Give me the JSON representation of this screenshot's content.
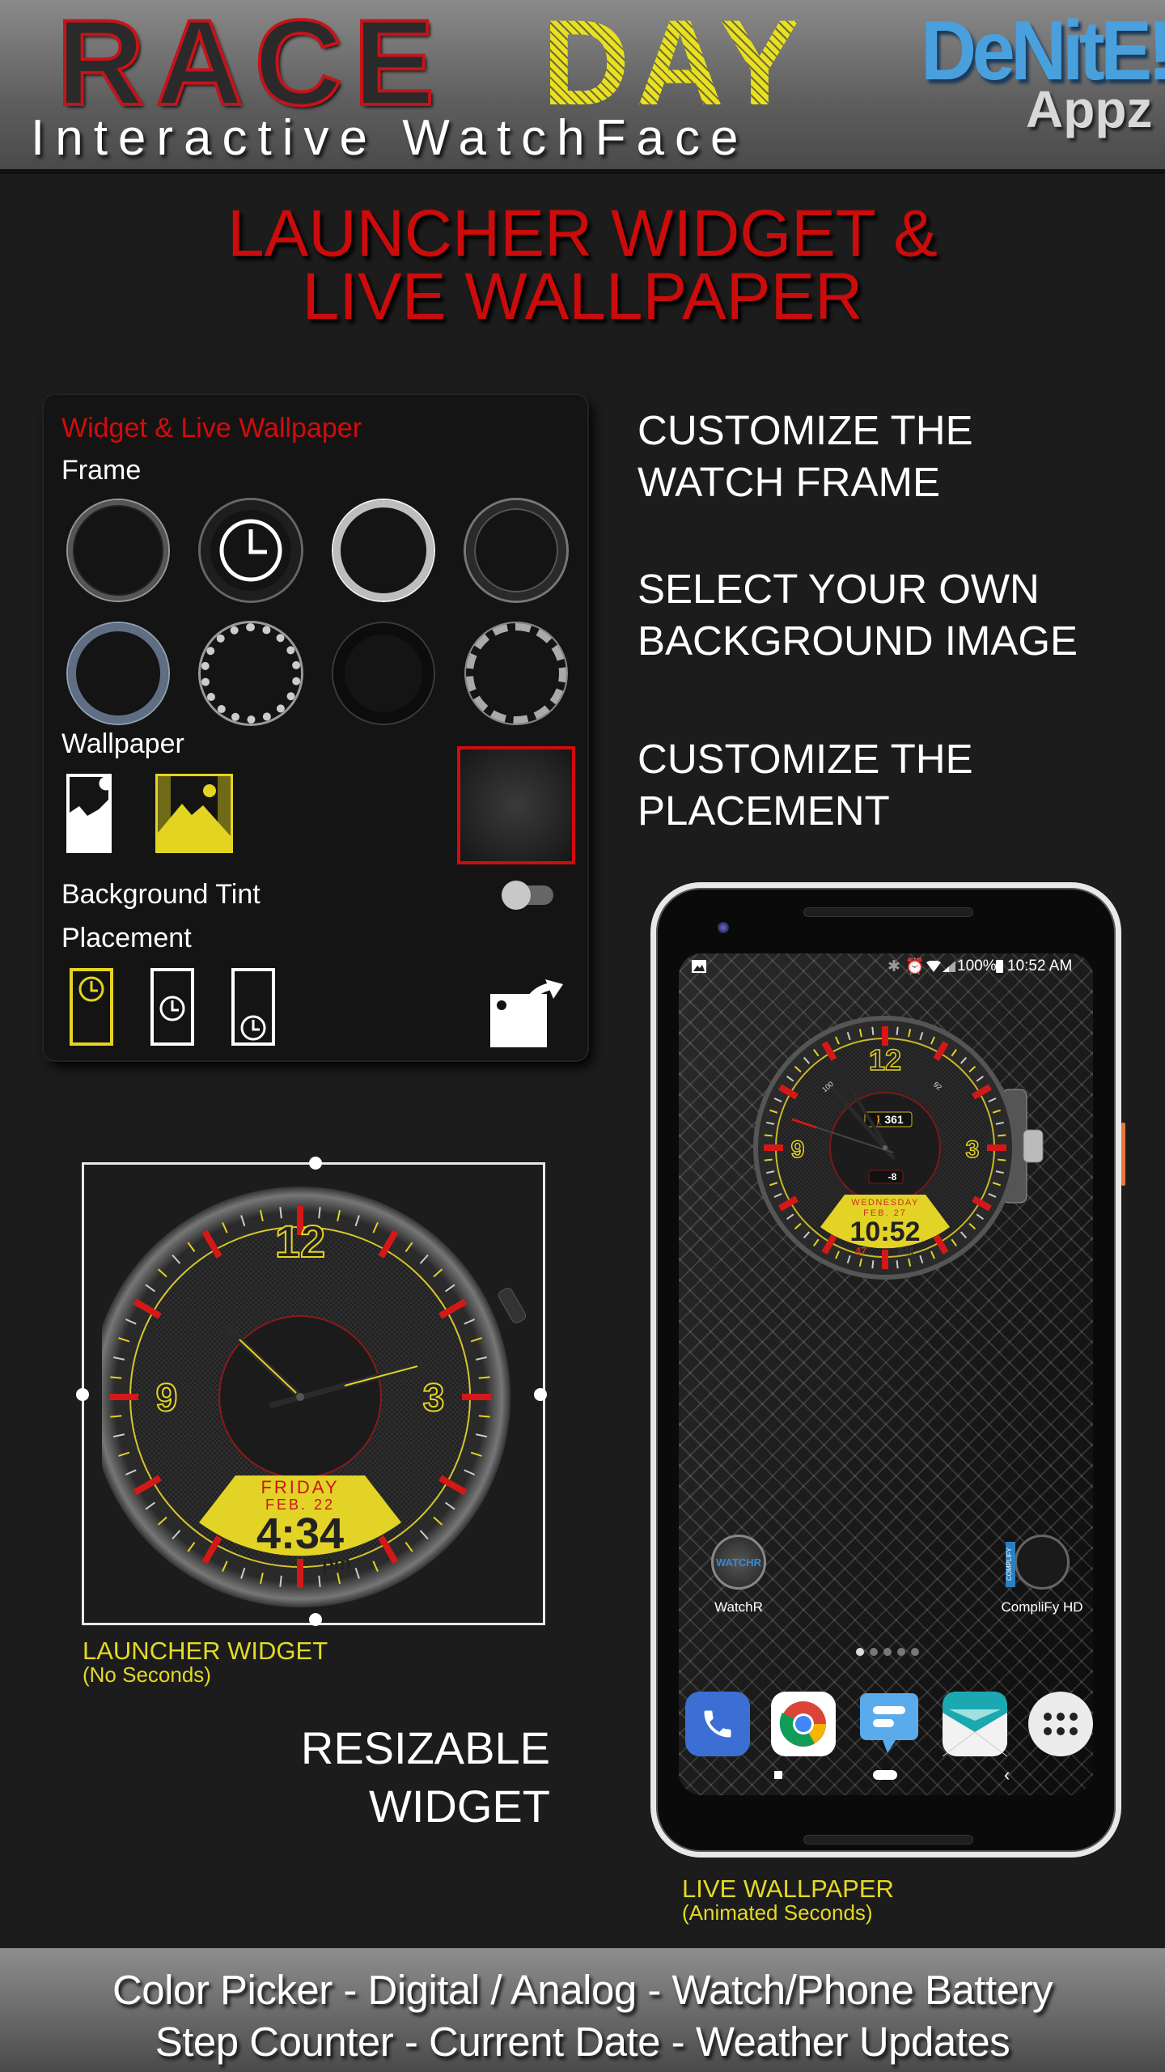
{
  "header": {
    "title_part1": "RACE",
    "title_part2": "DAY",
    "subtitle": "Interactive WatchFace",
    "brand_main": "DeNitE!",
    "brand_sub": "Appz"
  },
  "headline": {
    "line1": "LAUNCHER WIDGET &",
    "line2": "LIVE WALLPAPER"
  },
  "settings_panel": {
    "title": "Widget & Live Wallpaper",
    "frame_label": "Frame",
    "frames": [
      {
        "name": "frame-1-thin-bezel",
        "selected": false
      },
      {
        "name": "frame-2-racing",
        "selected": true
      },
      {
        "name": "frame-3-silver",
        "selected": false
      },
      {
        "name": "frame-4-black-chrome",
        "selected": false
      },
      {
        "name": "frame-5-blue-steel",
        "selected": false
      },
      {
        "name": "frame-6-jeweled",
        "selected": false
      },
      {
        "name": "frame-7-matte-black",
        "selected": false
      },
      {
        "name": "frame-8-knurled",
        "selected": false
      }
    ],
    "wallpaper_label": "Wallpaper",
    "wallpaper_options": [
      {
        "name": "wallpaper-scroll",
        "selected": false
      },
      {
        "name": "wallpaper-fixed",
        "selected": true
      }
    ],
    "background_tint_label": "Background Tint",
    "background_tint_on": false,
    "placement_label": "Placement",
    "placement_options": [
      {
        "name": "placement-top",
        "selected": true
      },
      {
        "name": "placement-center",
        "selected": false
      },
      {
        "name": "placement-bottom",
        "selected": false
      }
    ],
    "colors": {
      "accent_red": "#d10c0c",
      "accent_yellow": "#e3d422"
    }
  },
  "features": [
    {
      "line1": "CUSTOMIZE THE",
      "line2": "WATCH FRAME"
    },
    {
      "line1": "SELECT YOUR OWN",
      "line2": "BACKGROUND IMAGE"
    },
    {
      "line1": "CUSTOMIZE THE",
      "line2": "PLACEMENT"
    }
  ],
  "widget": {
    "hour_labels": {
      "h12": "12",
      "h3": "3",
      "h9": "9"
    },
    "day": "FRIDAY",
    "date": "FEB. 22",
    "time": "4:34",
    "ampm": "pm",
    "caption": "LAUNCHER WIDGET",
    "caption_sub": "(No Seconds)",
    "resizable_line1": "RESIZABLE",
    "resizable_line2": "WIDGET"
  },
  "phone": {
    "status": {
      "battery": "100%",
      "time": "10:52 AM"
    },
    "watch": {
      "hour_labels": {
        "h12": "12",
        "h3": "3",
        "h9": "9"
      },
      "steps": "361",
      "weather": "-8",
      "watch_battery": "92",
      "phone_battery": "100",
      "day": "WEDNESDAY",
      "date": "FEB. 27",
      "time": "10:52",
      "seconds": "47",
      "ampm": "AM"
    },
    "shortcuts": [
      {
        "label": "WatchR",
        "badge": "WATCHR"
      },
      {
        "label": "CompliFy HD",
        "badge": "COMPLIFY"
      }
    ],
    "page_dots": 5,
    "active_page": 1,
    "dock": [
      "Phone",
      "Chrome",
      "Messages",
      "Email",
      "Apps"
    ],
    "caption": "LIVE WALLPAPER",
    "caption_sub": "(Animated Seconds)"
  },
  "footer": {
    "line1": "Color Picker - Digital / Analog - Watch/Phone Battery",
    "line2": "Step Counter - Current Date - Weather Updates"
  }
}
